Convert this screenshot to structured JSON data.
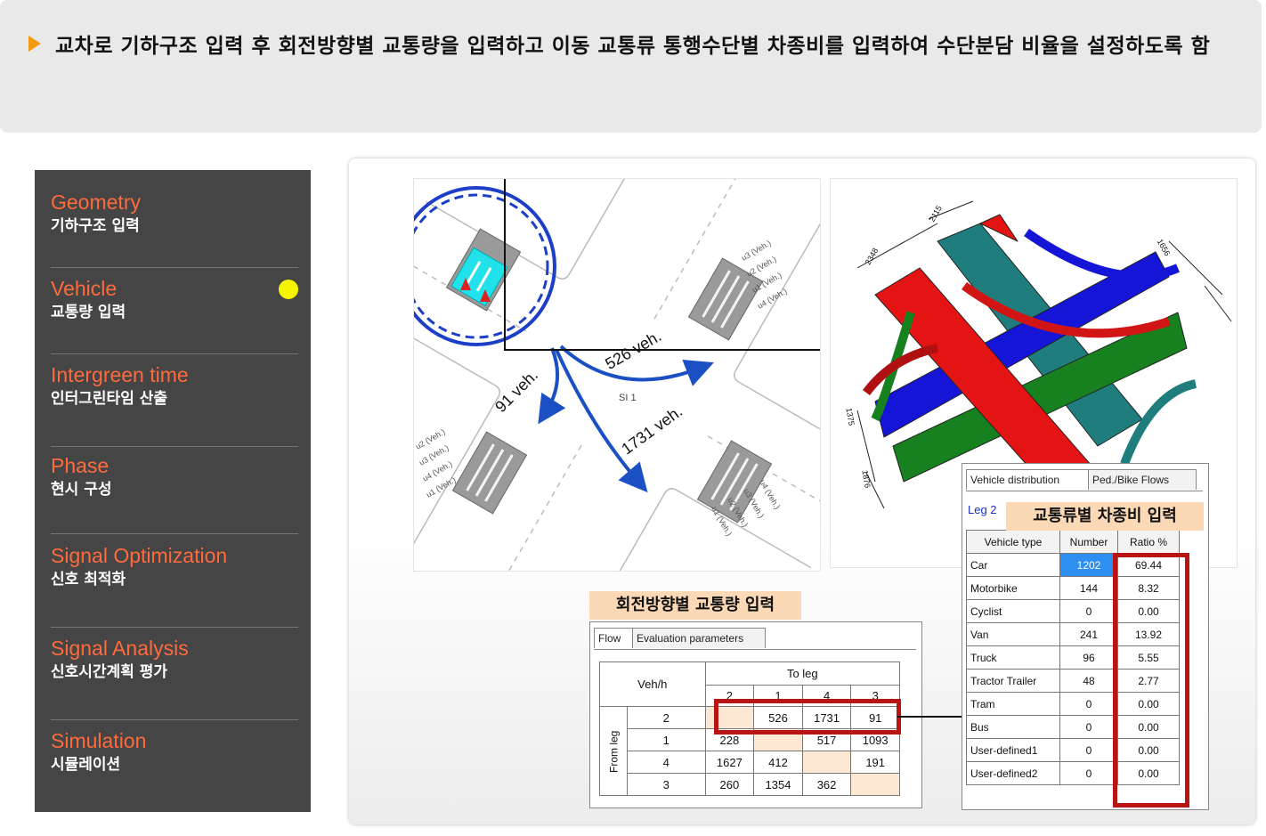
{
  "header": {
    "text": "교차로 기하구조 입력 후 회전방향별 교통량을 입력하고 이동 교통류 통행수단별 차종비를 입력하여 수단분담 비율을 설정하도록 함",
    "accent_color": "#f39a12"
  },
  "sidebar": {
    "items": [
      {
        "en": "Geometry",
        "ko": "기하구조 입력",
        "active": false
      },
      {
        "en": "Vehicle",
        "ko": "교통량 입력",
        "active": true
      },
      {
        "en": "Intergreen time",
        "ko": "인터그린타임 산출",
        "active": false
      },
      {
        "en": "Phase",
        "ko": "현시 구성",
        "active": false
      },
      {
        "en": "Signal Optimization",
        "ko": "신호 최적화",
        "active": false
      },
      {
        "en": "Signal Analysis",
        "ko": "신호시간계획 평가",
        "active": false
      },
      {
        "en": "Simulation",
        "ko": "시뮬레이션",
        "active": false
      }
    ],
    "title_color": "#ff6a3d",
    "active_dot_color": "#f5f500"
  },
  "intersection": {
    "flows": [
      "91 veh.",
      "526 veh.",
      "1731 veh."
    ],
    "node_label": "SI 1"
  },
  "flow_panel": {
    "label": "회전방향별 교통량 입력",
    "tabs": [
      "Flow",
      "Evaluation parameters"
    ],
    "corner": "Veh/h",
    "to_leg": "To leg",
    "from_leg": "From leg",
    "columns": [
      "2",
      "1",
      "4",
      "3"
    ],
    "rows": [
      {
        "leg": "2",
        "values": [
          "",
          "526",
          "1731",
          "91"
        ]
      },
      {
        "leg": "1",
        "values": [
          "228",
          "",
          "517",
          "1093"
        ]
      },
      {
        "leg": "4",
        "values": [
          "1627",
          "412",
          "",
          "191"
        ]
      },
      {
        "leg": "3",
        "values": [
          "260",
          "1354",
          "362",
          ""
        ]
      }
    ]
  },
  "vehicle_panel": {
    "label": "교통류별 차종비 입력",
    "tabs": [
      "Vehicle distribution",
      "Ped./Bike Flows"
    ],
    "leg": "Leg 2",
    "headers": [
      "Vehicle type",
      "Number",
      "Ratio %"
    ],
    "rows": [
      {
        "type": "Car",
        "number": "1202",
        "ratio": "69.44"
      },
      {
        "type": "Motorbike",
        "number": "144",
        "ratio": "8.32"
      },
      {
        "type": "Cyclist",
        "number": "0",
        "ratio": "0.00"
      },
      {
        "type": "Van",
        "number": "241",
        "ratio": "13.92"
      },
      {
        "type": "Truck",
        "number": "96",
        "ratio": "5.55"
      },
      {
        "type": "Tractor Trailer",
        "number": "48",
        "ratio": "2.77"
      },
      {
        "type": "Tram",
        "number": "0",
        "ratio": "0.00"
      },
      {
        "type": "Bus",
        "number": "0",
        "ratio": "0.00"
      },
      {
        "type": "User-defined1",
        "number": "0",
        "ratio": "0.00"
      },
      {
        "type": "User-defined2",
        "number": "0",
        "ratio": "0.00"
      }
    ]
  },
  "sankey": {
    "volumes": [
      "2115",
      "2348",
      "1656",
      "1375",
      "1876"
    ]
  }
}
